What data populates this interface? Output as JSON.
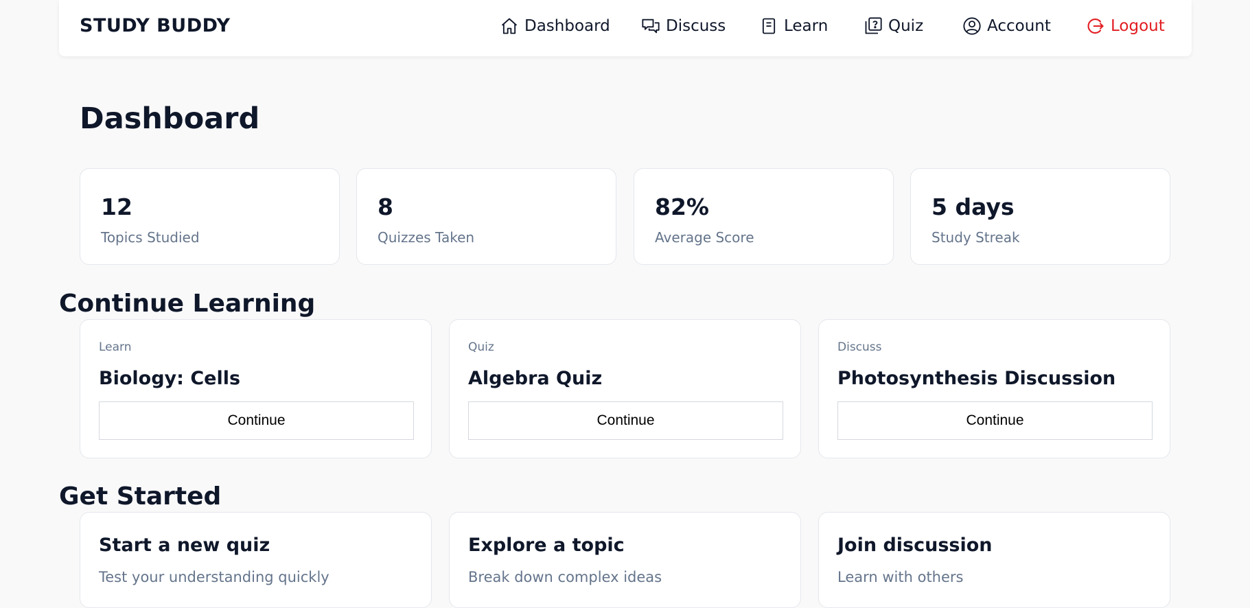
{
  "brand": "STUDY BUDDY",
  "nav": {
    "dashboard": "Dashboard",
    "discuss": "Discuss",
    "learn": "Learn",
    "quiz": "Quiz",
    "account": "Account",
    "logout": "Logout"
  },
  "page_title": "Dashboard",
  "stats": [
    {
      "value": "12",
      "label": "Topics Studied"
    },
    {
      "value": "8",
      "label": "Quizzes Taken"
    },
    {
      "value": "82%",
      "label": "Average Score"
    },
    {
      "value": "5 days",
      "label": "Study Streak"
    }
  ],
  "continue_learning": {
    "heading": "Continue Learning",
    "cards": [
      {
        "type": "Learn",
        "title": "Biology: Cells",
        "button": "Continue"
      },
      {
        "type": "Quiz",
        "title": "Algebra Quiz",
        "button": "Continue"
      },
      {
        "type": "Discuss",
        "title": "Photosynthesis Discussion",
        "button": "Continue"
      }
    ]
  },
  "get_started": {
    "heading": "Get Started",
    "cards": [
      {
        "title": "Start a new quiz",
        "description": "Test your understanding quickly"
      },
      {
        "title": "Explore a topic",
        "description": "Break down complex ideas"
      },
      {
        "title": "Join discussion",
        "description": "Learn with others"
      }
    ]
  },
  "icons": {
    "dashboard": "home-icon",
    "discuss": "chat-bubbles-icon",
    "learn": "document-icon",
    "quiz": "quiz-icon",
    "account": "user-circle-icon",
    "logout": "logout-icon"
  },
  "colors": {
    "background": "#f9f9f9",
    "text": "#0f172a",
    "muted": "#64748b",
    "logout": "#e11d22",
    "border": "#e4e7ec"
  }
}
